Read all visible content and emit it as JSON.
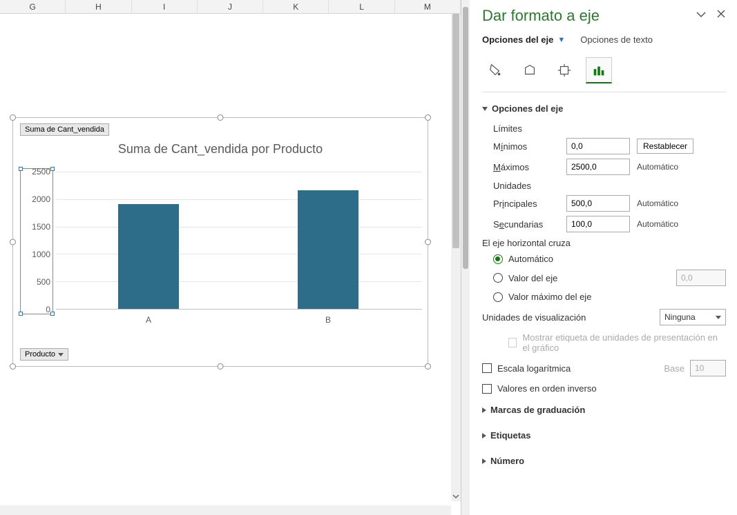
{
  "columns": [
    "G",
    "H",
    "I",
    "J",
    "K",
    "L",
    "M"
  ],
  "chart": {
    "field_button_top": "Suma de Cant_vendida",
    "field_button_bottom": "Producto",
    "title": "Suma de Cant_vendida por Producto"
  },
  "chart_data": {
    "type": "bar",
    "categories": [
      "A",
      "B"
    ],
    "values": [
      1900,
      2150
    ],
    "title": "Suma de Cant_vendida por Producto",
    "xlabel": "",
    "ylabel": "",
    "ylim": [
      0,
      2500
    ],
    "yticks": [
      0,
      500,
      1000,
      1500,
      2000,
      2500
    ]
  },
  "pane": {
    "title": "Dar formato a eje",
    "tab_active": "Opciones del eje",
    "tab_inactive": "Opciones de texto",
    "section_axis_options": "Opciones del eje",
    "limits_label": "Límites",
    "min_label_pre": "M",
    "min_label_ul": "í",
    "min_label_post": "nimos",
    "min_value": "0,0",
    "reset_label": "Restablecer",
    "max_label_pre": "",
    "max_label_ul": "M",
    "max_label_post": "áximos",
    "max_value": "2500,0",
    "auto_label": "Automático",
    "units_label": "Unidades",
    "major_label_pre": "Pr",
    "major_label_ul": "i",
    "major_label_post": "ncipales",
    "major_value": "500,0",
    "minor_label_pre": "S",
    "minor_label_ul": "e",
    "minor_label_post": "cundarias",
    "minor_value": "100,0",
    "cross_label": "El eje horizontal cruza",
    "radio_auto_pre": "Aut",
    "radio_auto_ul": "o",
    "radio_auto_post": "mático",
    "radio_value_pre": "Va",
    "radio_value_ul": "l",
    "radio_value_post": "or del eje",
    "radio_value_input": "0,0",
    "radio_max_pre": "Valor má",
    "radio_max_ul": "x",
    "radio_max_post": "imo del eje",
    "display_units_pre": "",
    "display_units_ul": "U",
    "display_units_post": "nidades de visualización",
    "display_units_value": "Ninguna",
    "show_label_pre": "Mostrar etiqueta de uni",
    "show_label_ul": "d",
    "show_label_post": "ades de presentación en el gráfico",
    "log_pre": "Escala l",
    "log_ul": "o",
    "log_post": "garítmica",
    "base_pre": "",
    "base_ul": "B",
    "base_post": "ase",
    "base_value": "10",
    "reverse_pre": "Valores en orden in",
    "reverse_ul": "v",
    "reverse_post": "erso",
    "section_tick": "Marcas de graduación",
    "section_labels": "Etiquetas",
    "section_number": "Número"
  }
}
